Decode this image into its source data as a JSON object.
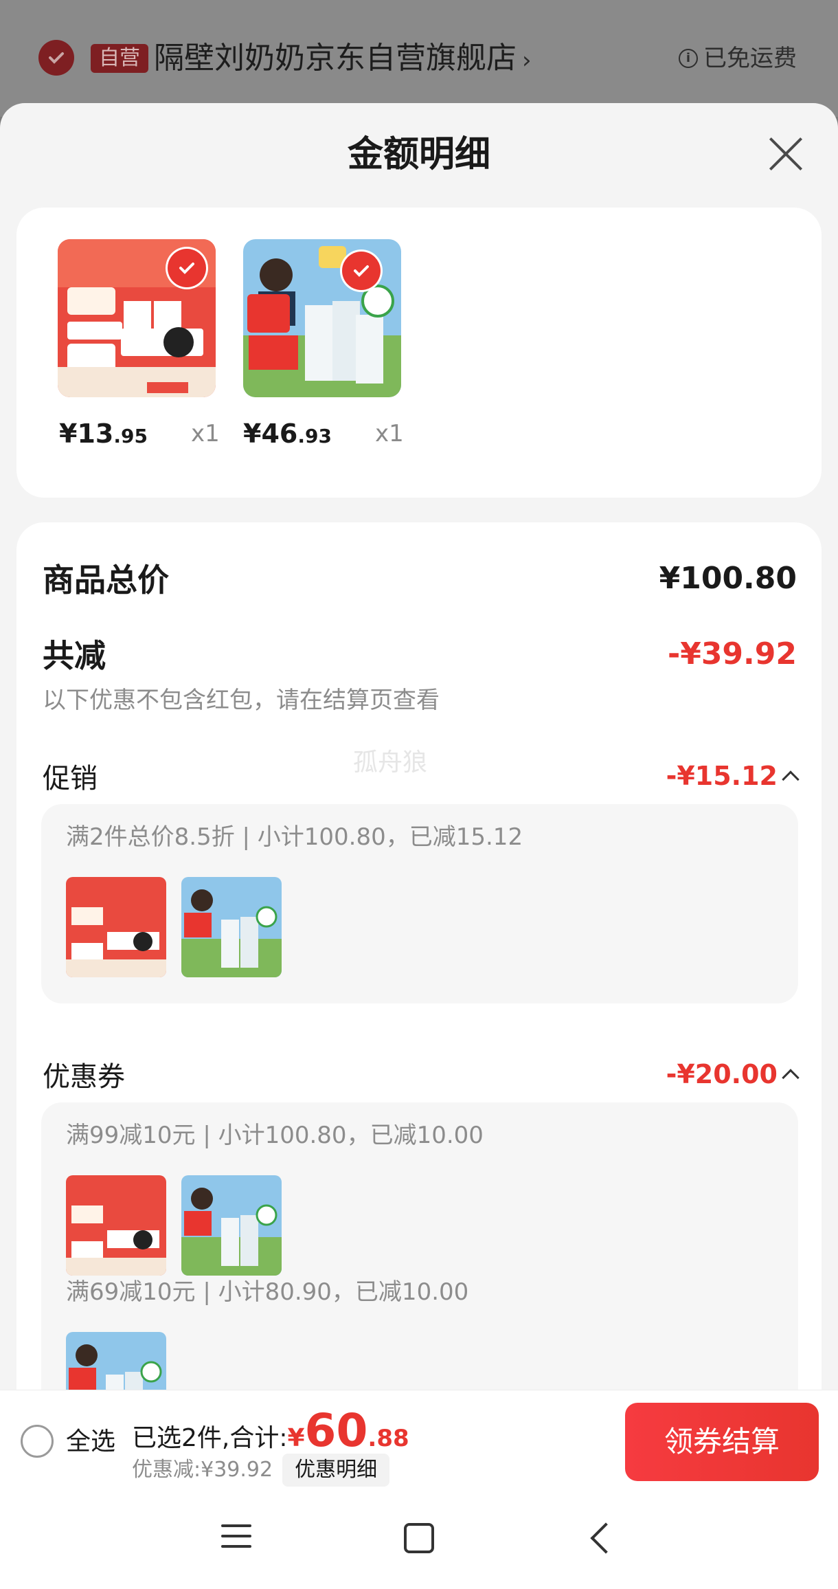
{
  "store": {
    "badge": "自营",
    "name": "隔壁刘奶奶京东自营旗舰店",
    "chevron": "›",
    "shipping": "已免运费",
    "info_icon": "i"
  },
  "sheet": {
    "title": "金额明细",
    "products": [
      {
        "price_int": "¥13",
        "price_dec": ".95",
        "qty": "x1",
        "image": "product-milk-trial-pack"
      },
      {
        "price_int": "¥46",
        "price_dec": ".93",
        "qty": "x1",
        "image": "product-anchor-milk-box"
      }
    ]
  },
  "detail": {
    "total_label": "商品总价",
    "total_value": "¥100.80",
    "reduce_label": "共减",
    "reduce_value": "-¥39.92",
    "note": "以下优惠不包含红包，请在结算页查看",
    "watermark": "孤舟狼",
    "promo": {
      "label": "促销",
      "value": "-¥15.12",
      "line": "满2件总价8.5折 | 小计100.80，已减15.12"
    },
    "coupon": {
      "label": "优惠券",
      "value": "-¥20.00",
      "line1": "满99减10元 | 小计100.80，已减10.00",
      "line2": "满69减10元 | 小计80.90，已减10.00"
    }
  },
  "bottom": {
    "select_all": "全选",
    "summary_label": "已选2件,合计:",
    "yen": "¥",
    "amount_int": "60",
    "amount_dec": ".88",
    "discount_text": "优惠减:¥39.92",
    "discount_button": "优惠明细",
    "checkout": "领券结算"
  },
  "colors": {
    "accent": "#e8352f",
    "muted": "#8c8c8c",
    "background": "#f4f4f4"
  }
}
